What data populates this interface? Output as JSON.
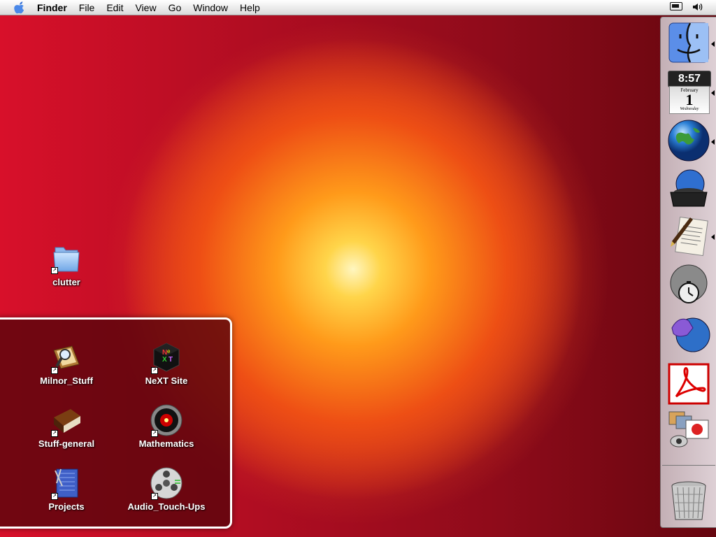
{
  "menubar": {
    "apple_icon": "apple-icon",
    "items": [
      "Finder",
      "File",
      "Edit",
      "View",
      "Go",
      "Window",
      "Help"
    ],
    "status_icons": [
      "battery-icon",
      "volume-icon"
    ]
  },
  "desktop": {
    "folder": {
      "label": "clutter",
      "icon": "folder-icon"
    }
  },
  "drawer": {
    "items": [
      {
        "label": "Milnor_Stuff",
        "icon": "magnifier-book-icon"
      },
      {
        "label": "NeXT Site",
        "icon": "next-cube-icon"
      },
      {
        "label": "Stuff-general",
        "icon": "brown-book-icon"
      },
      {
        "label": "Mathematics",
        "icon": "hal-eye-icon"
      },
      {
        "label": "Projects",
        "icon": "blueprint-icon"
      },
      {
        "label": "Audio_Touch-Ups",
        "icon": "reel-icon"
      }
    ]
  },
  "dock": {
    "clock": {
      "time": "8:57",
      "month": "February",
      "day": "1",
      "weekday": "Wednesday"
    },
    "items": [
      "finder-icon",
      "clock-calendar-icon",
      "globe-icon",
      "mail-bag-icon",
      "pen-letter-icon",
      "stopwatch-icon",
      "hand-globe-icon",
      "acrobat-icon",
      "photos-icon",
      "trash-icon"
    ]
  }
}
